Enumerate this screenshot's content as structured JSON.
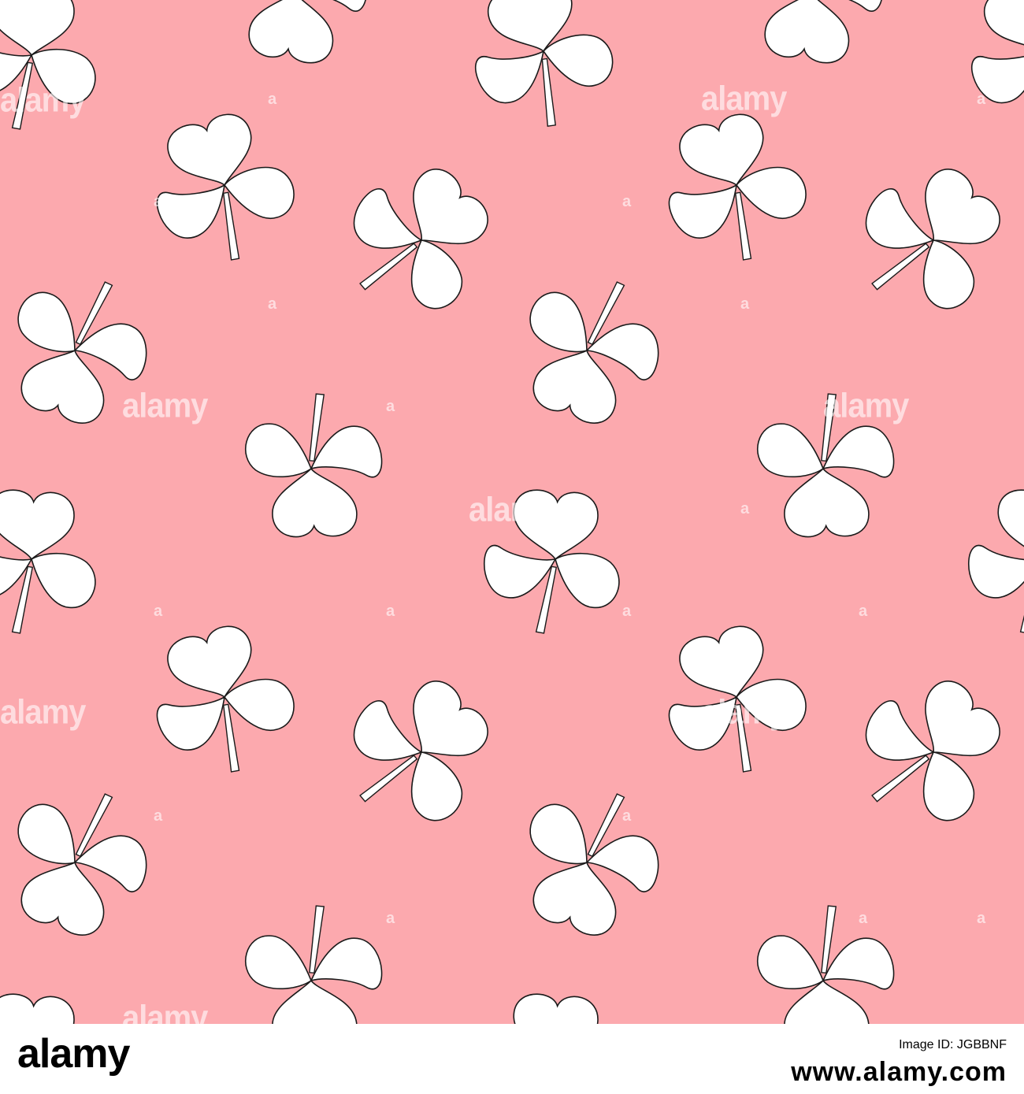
{
  "watermark": {
    "text": "alamy",
    "small_text": "a"
  },
  "footer": {
    "brand": "alamy",
    "image_id_label": "Image ID: JGBBNF",
    "image_id_url": "www.alamy.com",
    "image_id": "JGBBNF"
  },
  "colors": {
    "background": "#FCA9AE",
    "leaf_fill": "#FFFFFF",
    "leaf_outline": "#1A1A1A",
    "footer_bg": "#FFFFFF"
  },
  "icons": {
    "pattern_motif": "clover-icon"
  }
}
